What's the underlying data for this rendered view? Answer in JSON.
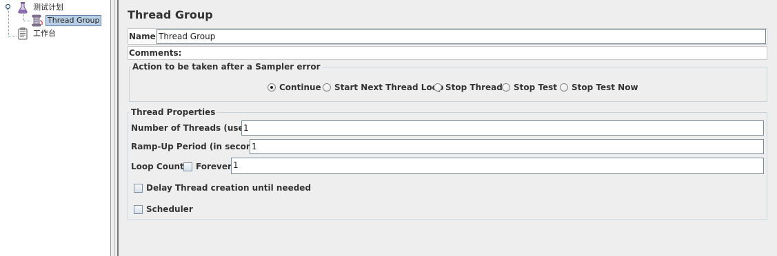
{
  "tree": {
    "root_label": "测试计划",
    "thread_group_label": "Thread Group",
    "workbench_label": "工作台"
  },
  "editor": {
    "title": "Thread Group",
    "name_label": "Name:",
    "name_value": "Thread Group",
    "comments_label": "Comments:",
    "comments_value": ""
  },
  "sampler_error": {
    "legend": "Action to be taken after a Sampler error",
    "options": [
      "Continue",
      "Start Next Thread Loop",
      "Stop Thread",
      "Stop Test",
      "Stop Test Now"
    ],
    "selected": "Continue"
  },
  "thread_properties": {
    "legend": "Thread Properties",
    "num_threads_label": "Number of Threads (users):",
    "num_threads_value": "1",
    "ramp_up_label": "Ramp-Up Period (in seconds):",
    "ramp_up_value": "1",
    "loop_count_label": "Loop Count:",
    "forever_label": "Forever",
    "forever_checked": false,
    "loop_count_value": "1",
    "delay_label": "Delay Thread creation until needed",
    "delay_checked": false,
    "scheduler_label": "Scheduler",
    "scheduler_checked": false
  },
  "colors": {
    "selection_bg": "#b8cfe5",
    "panel_bg": "#eeeeee",
    "border": "#c9d4dd"
  }
}
